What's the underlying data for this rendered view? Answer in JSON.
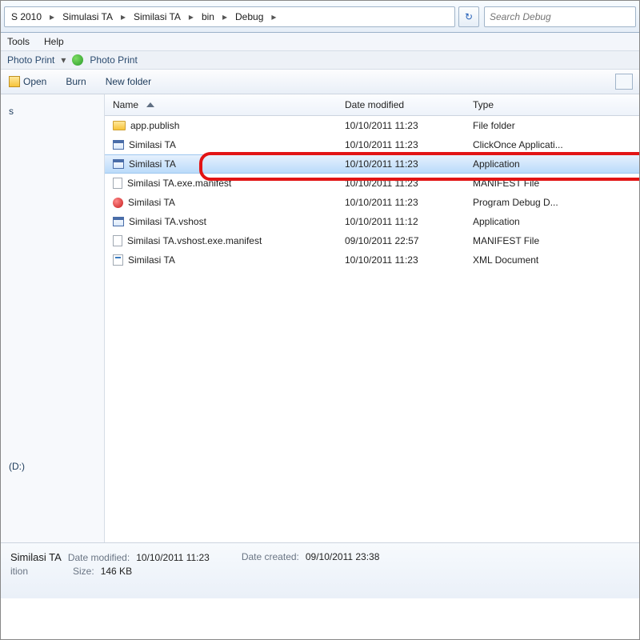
{
  "breadcrumbs": [
    "S 2010",
    "Simulasi TA",
    "Similasi TA",
    "bin",
    "Debug"
  ],
  "search": {
    "placeholder": "Search Debug"
  },
  "menu": {
    "tools": "Tools",
    "help": "Help"
  },
  "extra": {
    "photo_print1": "Photo Print",
    "photo_print2": "Photo Print"
  },
  "toolbar": {
    "open": "Open",
    "burn": "Burn",
    "newfolder": "New folder"
  },
  "columns": {
    "name": "Name",
    "date": "Date modified",
    "type": "Type"
  },
  "files": [
    {
      "name": "app.publish",
      "date": "10/10/2011 11:23",
      "type": "File folder",
      "icon": "folder"
    },
    {
      "name": "Similasi TA",
      "date": "10/10/2011 11:23",
      "type": "ClickOnce Applicati...",
      "icon": "app"
    },
    {
      "name": "Similasi TA",
      "date": "10/10/2011 11:23",
      "type": "Application",
      "icon": "app",
      "selected": true
    },
    {
      "name": "Similasi TA.exe.manifest",
      "date": "10/10/2011 11:23",
      "type": "MANIFEST File",
      "icon": "file"
    },
    {
      "name": "Similasi TA",
      "date": "10/10/2011 11:23",
      "type": "Program Debug D...",
      "icon": "pdb"
    },
    {
      "name": "Similasi TA.vshost",
      "date": "10/10/2011 11:12",
      "type": "Application",
      "icon": "app"
    },
    {
      "name": "Similasi TA.vshost.exe.manifest",
      "date": "09/10/2011 22:57",
      "type": "MANIFEST File",
      "icon": "file"
    },
    {
      "name": "Similasi TA",
      "date": "10/10/2011 11:23",
      "type": "XML Document",
      "icon": "xml"
    }
  ],
  "nav": {
    "item_s": "s",
    "drive": "(D:)"
  },
  "details": {
    "name": "Similasi TA",
    "date_modified_label": "Date modified:",
    "date_modified": "10/10/2011 11:23",
    "date_created_label": "Date created:",
    "date_created": "09/10/2011 23:38",
    "type_label": "ition",
    "size_label": "Size:",
    "size": "146 KB"
  }
}
